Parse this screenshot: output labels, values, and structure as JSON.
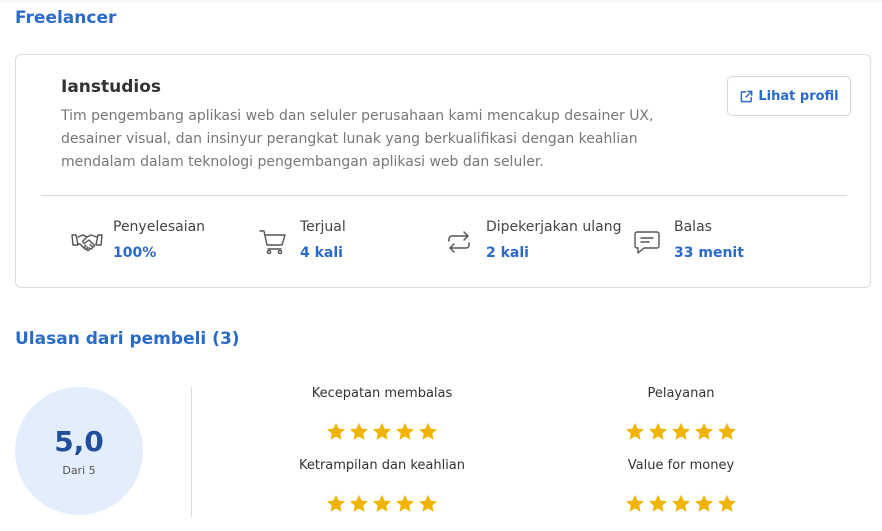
{
  "freelancer_section": {
    "title": "Freelancer"
  },
  "profile": {
    "name": "Ianstudios",
    "description": "Tim pengembang aplikasi web dan seluler perusahaan kami mencakup desainer UX, desainer visual, dan insinyur perangkat lunak yang berkualifikasi dengan keahlian mendalam dalam teknologi pengembangan aplikasi web dan seluler.",
    "profile_button": {
      "label": "Lihat profil",
      "icon": "external-link-icon"
    }
  },
  "stats": [
    {
      "label": "Penyelesaian",
      "value": "100%",
      "icon": "handshake-icon"
    },
    {
      "label": "Terjual",
      "value": "4 kali",
      "icon": "cart-icon"
    },
    {
      "label": "Dipekerjakan ulang",
      "value": "2 kali",
      "icon": "repeat-icon"
    },
    {
      "label": "Balas",
      "value": "33 menit",
      "icon": "chat-icon"
    }
  ],
  "reviews": {
    "title": "Ulasan dari pembeli (3)",
    "score": "5,0",
    "score_sub": "Dari 5",
    "criteria": [
      {
        "label": "Kecepatan membalas",
        "stars": 5
      },
      {
        "label": "Pelayanan",
        "stars": 5
      },
      {
        "label": "Ketrampilan dan keahlian",
        "stars": 5
      },
      {
        "label": "Value for money",
        "stars": 5
      }
    ],
    "star_color": "#f0b400"
  },
  "colors": {
    "accent": "#2a6bc9",
    "score_bg": "#e3edfb"
  }
}
